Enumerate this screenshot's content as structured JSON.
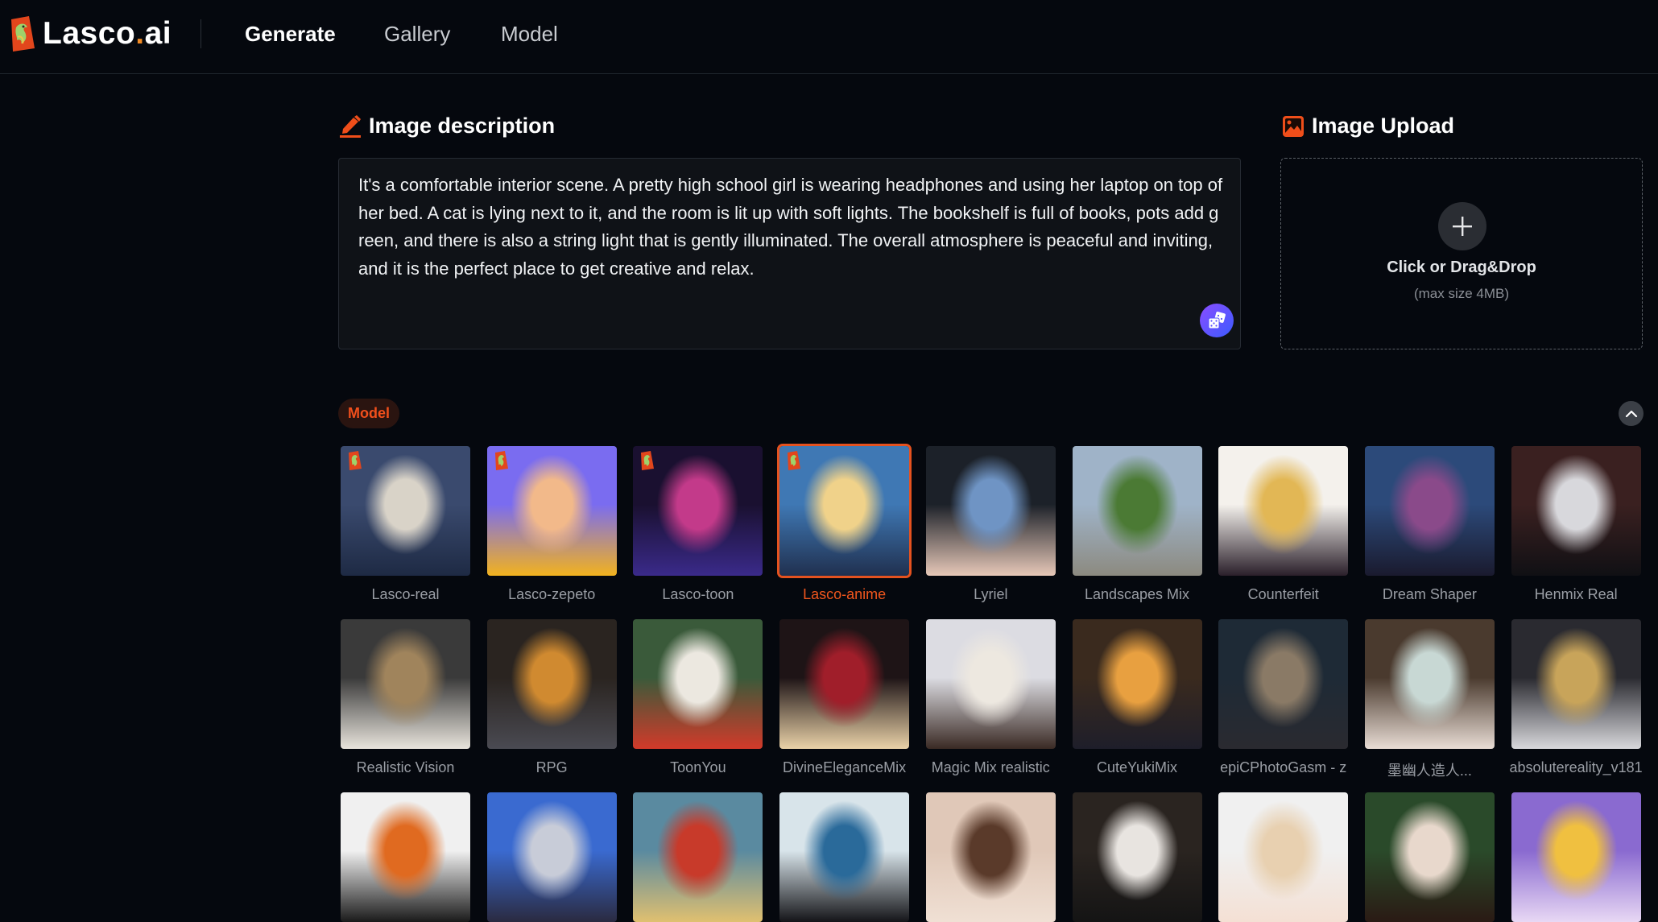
{
  "header": {
    "logo_text_main": "Lasco",
    "logo_text_dot": ".",
    "logo_text_suffix": "ai",
    "nav": [
      {
        "label": "Generate",
        "active": true
      },
      {
        "label": "Gallery",
        "active": false
      },
      {
        "label": "Model",
        "active": false
      }
    ]
  },
  "description": {
    "title": "Image description",
    "title_icon": "pencil-icon",
    "text": "It's a comfortable interior scene. A pretty high school girl is wearing headphones and using her laptop on top of her bed. A cat is lying next to it, and the room is lit up with soft lights. The bookshelf is full of books, pots add green, and there is also a string light that is gently illuminated. The overall atmosphere is peaceful and inviting, and it is the perfect place to get creative and relax.",
    "random_button_icon": "dice-icon"
  },
  "upload": {
    "title": "Image Upload",
    "title_icon": "image-icon",
    "prompt": "Click or Drag&Drop",
    "limit": "(max size 4MB)",
    "add_icon": "plus-icon"
  },
  "model_section": {
    "badge": "Model",
    "collapse_icon": "chevron-up-icon",
    "selected": "Lasco-anime",
    "models": [
      {
        "name": "Lasco-real",
        "lasco_badge": true,
        "colors": [
          "#3a4a6e",
          "#d9d3c8",
          "#1e2a44"
        ]
      },
      {
        "name": "Lasco-zepeto",
        "lasco_badge": true,
        "colors": [
          "#7a6cf0",
          "#f2b98a",
          "#f2b21e"
        ]
      },
      {
        "name": "Lasco-toon",
        "lasco_badge": true,
        "colors": [
          "#1a1030",
          "#c33a8a",
          "#3a2a8a"
        ]
      },
      {
        "name": "Lasco-anime",
        "lasco_badge": true,
        "colors": [
          "#3f78b4",
          "#f0d28a",
          "#20304f"
        ]
      },
      {
        "name": "Lyriel",
        "lasco_badge": false,
        "colors": [
          "#1c2129",
          "#6f94c4",
          "#e7c8b8"
        ]
      },
      {
        "name": "Landscapes Mix",
        "lasco_badge": false,
        "colors": [
          "#9fb3c8",
          "#4b7a34",
          "#8c8a80"
        ]
      },
      {
        "name": "Counterfeit",
        "lasco_badge": false,
        "colors": [
          "#f4f1ec",
          "#e2b755",
          "#2a1f2a"
        ]
      },
      {
        "name": "Dream Shaper",
        "lasco_badge": false,
        "colors": [
          "#2c4a7a",
          "#8a4a8a",
          "#1a1a2e"
        ]
      },
      {
        "name": "Henmix Real",
        "lasco_badge": false,
        "colors": [
          "#3a2020",
          "#d8d8dc",
          "#101014"
        ]
      },
      {
        "name": "Realistic Vision",
        "lasco_badge": false,
        "colors": [
          "#3a3a3a",
          "#a0845c",
          "#e8e4dc"
        ]
      },
      {
        "name": "RPG",
        "lasco_badge": false,
        "colors": [
          "#2a2420",
          "#d08a30",
          "#4a4a52"
        ]
      },
      {
        "name": "ToonYou",
        "lasco_badge": false,
        "colors": [
          "#3a5a3a",
          "#ece8e0",
          "#d23a2a"
        ]
      },
      {
        "name": "DivineEleganceMix",
        "lasco_badge": false,
        "colors": [
          "#1e1416",
          "#a01e2a",
          "#ead2a8"
        ]
      },
      {
        "name": "Magic Mix realistic",
        "lasco_badge": false,
        "colors": [
          "#dcdce2",
          "#ede8e0",
          "#3a2a24"
        ]
      },
      {
        "name": "CuteYukiMix",
        "lasco_badge": false,
        "colors": [
          "#3a2a1e",
          "#e8a040",
          "#1e1e2a"
        ]
      },
      {
        "name": "epiCPhotoGasm - z",
        "lasco_badge": false,
        "colors": [
          "#1e2a36",
          "#8a7a66",
          "#2a2a30"
        ]
      },
      {
        "name": "墨幽人造人...",
        "lasco_badge": false,
        "colors": [
          "#4a3a2e",
          "#c8d8d4",
          "#e8dcd4"
        ]
      },
      {
        "name": "absolutereality_v181",
        "lasco_badge": false,
        "colors": [
          "#2a2a30",
          "#c8a45a",
          "#d8d8dc"
        ]
      },
      {
        "name": "",
        "lasco_badge": false,
        "colors": [
          "#f0f0f0",
          "#e06a20",
          "#1a1a1a"
        ]
      },
      {
        "name": "",
        "lasco_badge": false,
        "colors": [
          "#3a6ad0",
          "#c8ccd8",
          "#2a2a40"
        ]
      },
      {
        "name": "",
        "lasco_badge": false,
        "colors": [
          "#5a8aa0",
          "#c83a2a",
          "#e0c070"
        ]
      },
      {
        "name": "",
        "lasco_badge": false,
        "colors": [
          "#d8e4ea",
          "#2a6a9a",
          "#141418"
        ]
      },
      {
        "name": "",
        "lasco_badge": false,
        "colors": [
          "#e0c8b8",
          "#5a3a2a",
          "#f0e0d4"
        ]
      },
      {
        "name": "",
        "lasco_badge": false,
        "colors": [
          "#2a2420",
          "#e8e4e0",
          "#141414"
        ]
      },
      {
        "name": "",
        "lasco_badge": false,
        "colors": [
          "#f0f0f0",
          "#e8d0b0",
          "#f4e0d4"
        ]
      },
      {
        "name": "",
        "lasco_badge": false,
        "colors": [
          "#2a4a2a",
          "#e8d8cc",
          "#2a1a14"
        ]
      },
      {
        "name": "",
        "lasco_badge": false,
        "colors": [
          "#8a6ad0",
          "#f0c040",
          "#e8d8f4"
        ]
      }
    ]
  }
}
